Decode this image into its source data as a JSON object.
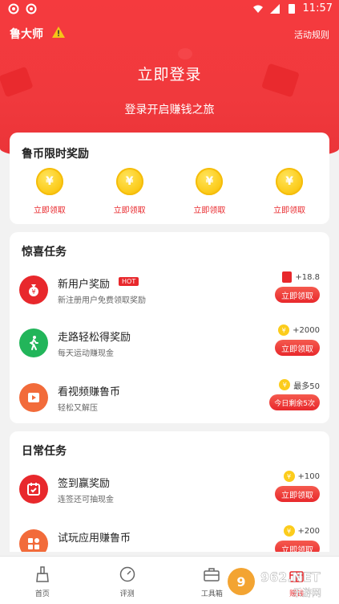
{
  "status_bar": {
    "time": "11:57"
  },
  "header": {
    "app_name": "鲁大师",
    "rules_link": "活动规则",
    "login_title": "立即登录",
    "login_subtitle": "登录开启赚钱之旅"
  },
  "colors": {
    "brand_red": "#e8282c",
    "coin_yellow": "#fccc1c"
  },
  "limited_rewards": {
    "title": "鲁币限时奖励",
    "items": [
      {
        "icon": "yen-coin-icon",
        "label": "立即领取"
      },
      {
        "icon": "yen-coin-icon",
        "label": "立即领取"
      },
      {
        "icon": "yen-coin-icon",
        "label": "立即领取"
      },
      {
        "icon": "yen-coin-icon",
        "label": "立即领取"
      }
    ]
  },
  "surprise_tasks": {
    "title": "惊喜任务",
    "items": [
      {
        "icon": "money-bag-icon",
        "name": "新用户奖励",
        "badge": "HOT",
        "desc": "新注册用户免费领取奖励",
        "reward": "+18.8",
        "reward_icon": "red-envelope-icon",
        "button": "立即领取"
      },
      {
        "icon": "walking-person-icon",
        "name": "走路轻松得奖励",
        "desc": "每天运动赚现金",
        "reward": "+2000",
        "reward_icon": "yen-coin-icon",
        "button": "立即领取"
      },
      {
        "icon": "video-play-icon",
        "name": "看视频赚鲁币",
        "desc": "轻松又解压",
        "reward": "最多50",
        "reward_icon": "yen-coin-icon",
        "button": "今日剩余5次"
      }
    ]
  },
  "daily_tasks": {
    "title": "日常任务",
    "items": [
      {
        "icon": "calendar-check-icon",
        "name": "签到赢奖励",
        "desc": "连签还可抽现金",
        "reward": "+100",
        "reward_icon": "yen-coin-icon",
        "button": "立即领取"
      },
      {
        "icon": "apps-grid-icon",
        "name": "试玩应用赚鲁币",
        "desc": "",
        "reward": "+200",
        "reward_icon": "yen-coin-icon",
        "button": "立即领取"
      }
    ]
  },
  "bottom_nav": [
    {
      "icon": "broom-icon",
      "label": "首页"
    },
    {
      "icon": "gauge-icon",
      "label": "评测"
    },
    {
      "icon": "toolbox-icon",
      "label": "工具箱"
    },
    {
      "icon": "gift-icon",
      "label": "赚钱"
    }
  ],
  "watermark": {
    "brand": "962.NET",
    "subtitle": "乐游网"
  }
}
